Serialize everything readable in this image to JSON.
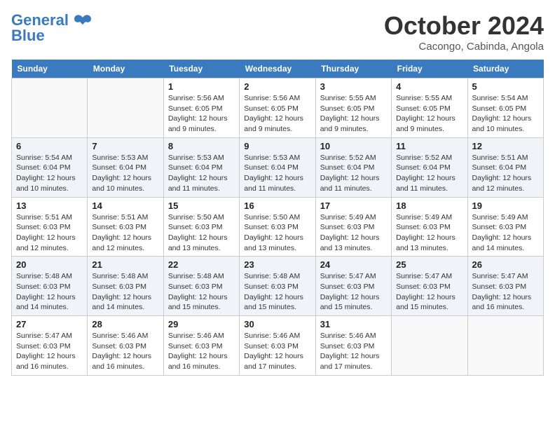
{
  "header": {
    "logo_general": "General",
    "logo_blue": "Blue",
    "month_title": "October 2024",
    "location": "Cacongo, Cabinda, Angola"
  },
  "days_of_week": [
    "Sunday",
    "Monday",
    "Tuesday",
    "Wednesday",
    "Thursday",
    "Friday",
    "Saturday"
  ],
  "weeks": [
    [
      {
        "day": "",
        "sunrise": "",
        "sunset": "",
        "daylight": ""
      },
      {
        "day": "",
        "sunrise": "",
        "sunset": "",
        "daylight": ""
      },
      {
        "day": "1",
        "sunrise": "Sunrise: 5:56 AM",
        "sunset": "Sunset: 6:05 PM",
        "daylight": "Daylight: 12 hours and 9 minutes."
      },
      {
        "day": "2",
        "sunrise": "Sunrise: 5:56 AM",
        "sunset": "Sunset: 6:05 PM",
        "daylight": "Daylight: 12 hours and 9 minutes."
      },
      {
        "day": "3",
        "sunrise": "Sunrise: 5:55 AM",
        "sunset": "Sunset: 6:05 PM",
        "daylight": "Daylight: 12 hours and 9 minutes."
      },
      {
        "day": "4",
        "sunrise": "Sunrise: 5:55 AM",
        "sunset": "Sunset: 6:05 PM",
        "daylight": "Daylight: 12 hours and 9 minutes."
      },
      {
        "day": "5",
        "sunrise": "Sunrise: 5:54 AM",
        "sunset": "Sunset: 6:05 PM",
        "daylight": "Daylight: 12 hours and 10 minutes."
      }
    ],
    [
      {
        "day": "6",
        "sunrise": "Sunrise: 5:54 AM",
        "sunset": "Sunset: 6:04 PM",
        "daylight": "Daylight: 12 hours and 10 minutes."
      },
      {
        "day": "7",
        "sunrise": "Sunrise: 5:53 AM",
        "sunset": "Sunset: 6:04 PM",
        "daylight": "Daylight: 12 hours and 10 minutes."
      },
      {
        "day": "8",
        "sunrise": "Sunrise: 5:53 AM",
        "sunset": "Sunset: 6:04 PM",
        "daylight": "Daylight: 12 hours and 11 minutes."
      },
      {
        "day": "9",
        "sunrise": "Sunrise: 5:53 AM",
        "sunset": "Sunset: 6:04 PM",
        "daylight": "Daylight: 12 hours and 11 minutes."
      },
      {
        "day": "10",
        "sunrise": "Sunrise: 5:52 AM",
        "sunset": "Sunset: 6:04 PM",
        "daylight": "Daylight: 12 hours and 11 minutes."
      },
      {
        "day": "11",
        "sunrise": "Sunrise: 5:52 AM",
        "sunset": "Sunset: 6:04 PM",
        "daylight": "Daylight: 12 hours and 11 minutes."
      },
      {
        "day": "12",
        "sunrise": "Sunrise: 5:51 AM",
        "sunset": "Sunset: 6:04 PM",
        "daylight": "Daylight: 12 hours and 12 minutes."
      }
    ],
    [
      {
        "day": "13",
        "sunrise": "Sunrise: 5:51 AM",
        "sunset": "Sunset: 6:03 PM",
        "daylight": "Daylight: 12 hours and 12 minutes."
      },
      {
        "day": "14",
        "sunrise": "Sunrise: 5:51 AM",
        "sunset": "Sunset: 6:03 PM",
        "daylight": "Daylight: 12 hours and 12 minutes."
      },
      {
        "day": "15",
        "sunrise": "Sunrise: 5:50 AM",
        "sunset": "Sunset: 6:03 PM",
        "daylight": "Daylight: 12 hours and 13 minutes."
      },
      {
        "day": "16",
        "sunrise": "Sunrise: 5:50 AM",
        "sunset": "Sunset: 6:03 PM",
        "daylight": "Daylight: 12 hours and 13 minutes."
      },
      {
        "day": "17",
        "sunrise": "Sunrise: 5:49 AM",
        "sunset": "Sunset: 6:03 PM",
        "daylight": "Daylight: 12 hours and 13 minutes."
      },
      {
        "day": "18",
        "sunrise": "Sunrise: 5:49 AM",
        "sunset": "Sunset: 6:03 PM",
        "daylight": "Daylight: 12 hours and 13 minutes."
      },
      {
        "day": "19",
        "sunrise": "Sunrise: 5:49 AM",
        "sunset": "Sunset: 6:03 PM",
        "daylight": "Daylight: 12 hours and 14 minutes."
      }
    ],
    [
      {
        "day": "20",
        "sunrise": "Sunrise: 5:48 AM",
        "sunset": "Sunset: 6:03 PM",
        "daylight": "Daylight: 12 hours and 14 minutes."
      },
      {
        "day": "21",
        "sunrise": "Sunrise: 5:48 AM",
        "sunset": "Sunset: 6:03 PM",
        "daylight": "Daylight: 12 hours and 14 minutes."
      },
      {
        "day": "22",
        "sunrise": "Sunrise: 5:48 AM",
        "sunset": "Sunset: 6:03 PM",
        "daylight": "Daylight: 12 hours and 15 minutes."
      },
      {
        "day": "23",
        "sunrise": "Sunrise: 5:48 AM",
        "sunset": "Sunset: 6:03 PM",
        "daylight": "Daylight: 12 hours and 15 minutes."
      },
      {
        "day": "24",
        "sunrise": "Sunrise: 5:47 AM",
        "sunset": "Sunset: 6:03 PM",
        "daylight": "Daylight: 12 hours and 15 minutes."
      },
      {
        "day": "25",
        "sunrise": "Sunrise: 5:47 AM",
        "sunset": "Sunset: 6:03 PM",
        "daylight": "Daylight: 12 hours and 15 minutes."
      },
      {
        "day": "26",
        "sunrise": "Sunrise: 5:47 AM",
        "sunset": "Sunset: 6:03 PM",
        "daylight": "Daylight: 12 hours and 16 minutes."
      }
    ],
    [
      {
        "day": "27",
        "sunrise": "Sunrise: 5:47 AM",
        "sunset": "Sunset: 6:03 PM",
        "daylight": "Daylight: 12 hours and 16 minutes."
      },
      {
        "day": "28",
        "sunrise": "Sunrise: 5:46 AM",
        "sunset": "Sunset: 6:03 PM",
        "daylight": "Daylight: 12 hours and 16 minutes."
      },
      {
        "day": "29",
        "sunrise": "Sunrise: 5:46 AM",
        "sunset": "Sunset: 6:03 PM",
        "daylight": "Daylight: 12 hours and 16 minutes."
      },
      {
        "day": "30",
        "sunrise": "Sunrise: 5:46 AM",
        "sunset": "Sunset: 6:03 PM",
        "daylight": "Daylight: 12 hours and 17 minutes."
      },
      {
        "day": "31",
        "sunrise": "Sunrise: 5:46 AM",
        "sunset": "Sunset: 6:03 PM",
        "daylight": "Daylight: 12 hours and 17 minutes."
      },
      {
        "day": "",
        "sunrise": "",
        "sunset": "",
        "daylight": ""
      },
      {
        "day": "",
        "sunrise": "",
        "sunset": "",
        "daylight": ""
      }
    ]
  ]
}
